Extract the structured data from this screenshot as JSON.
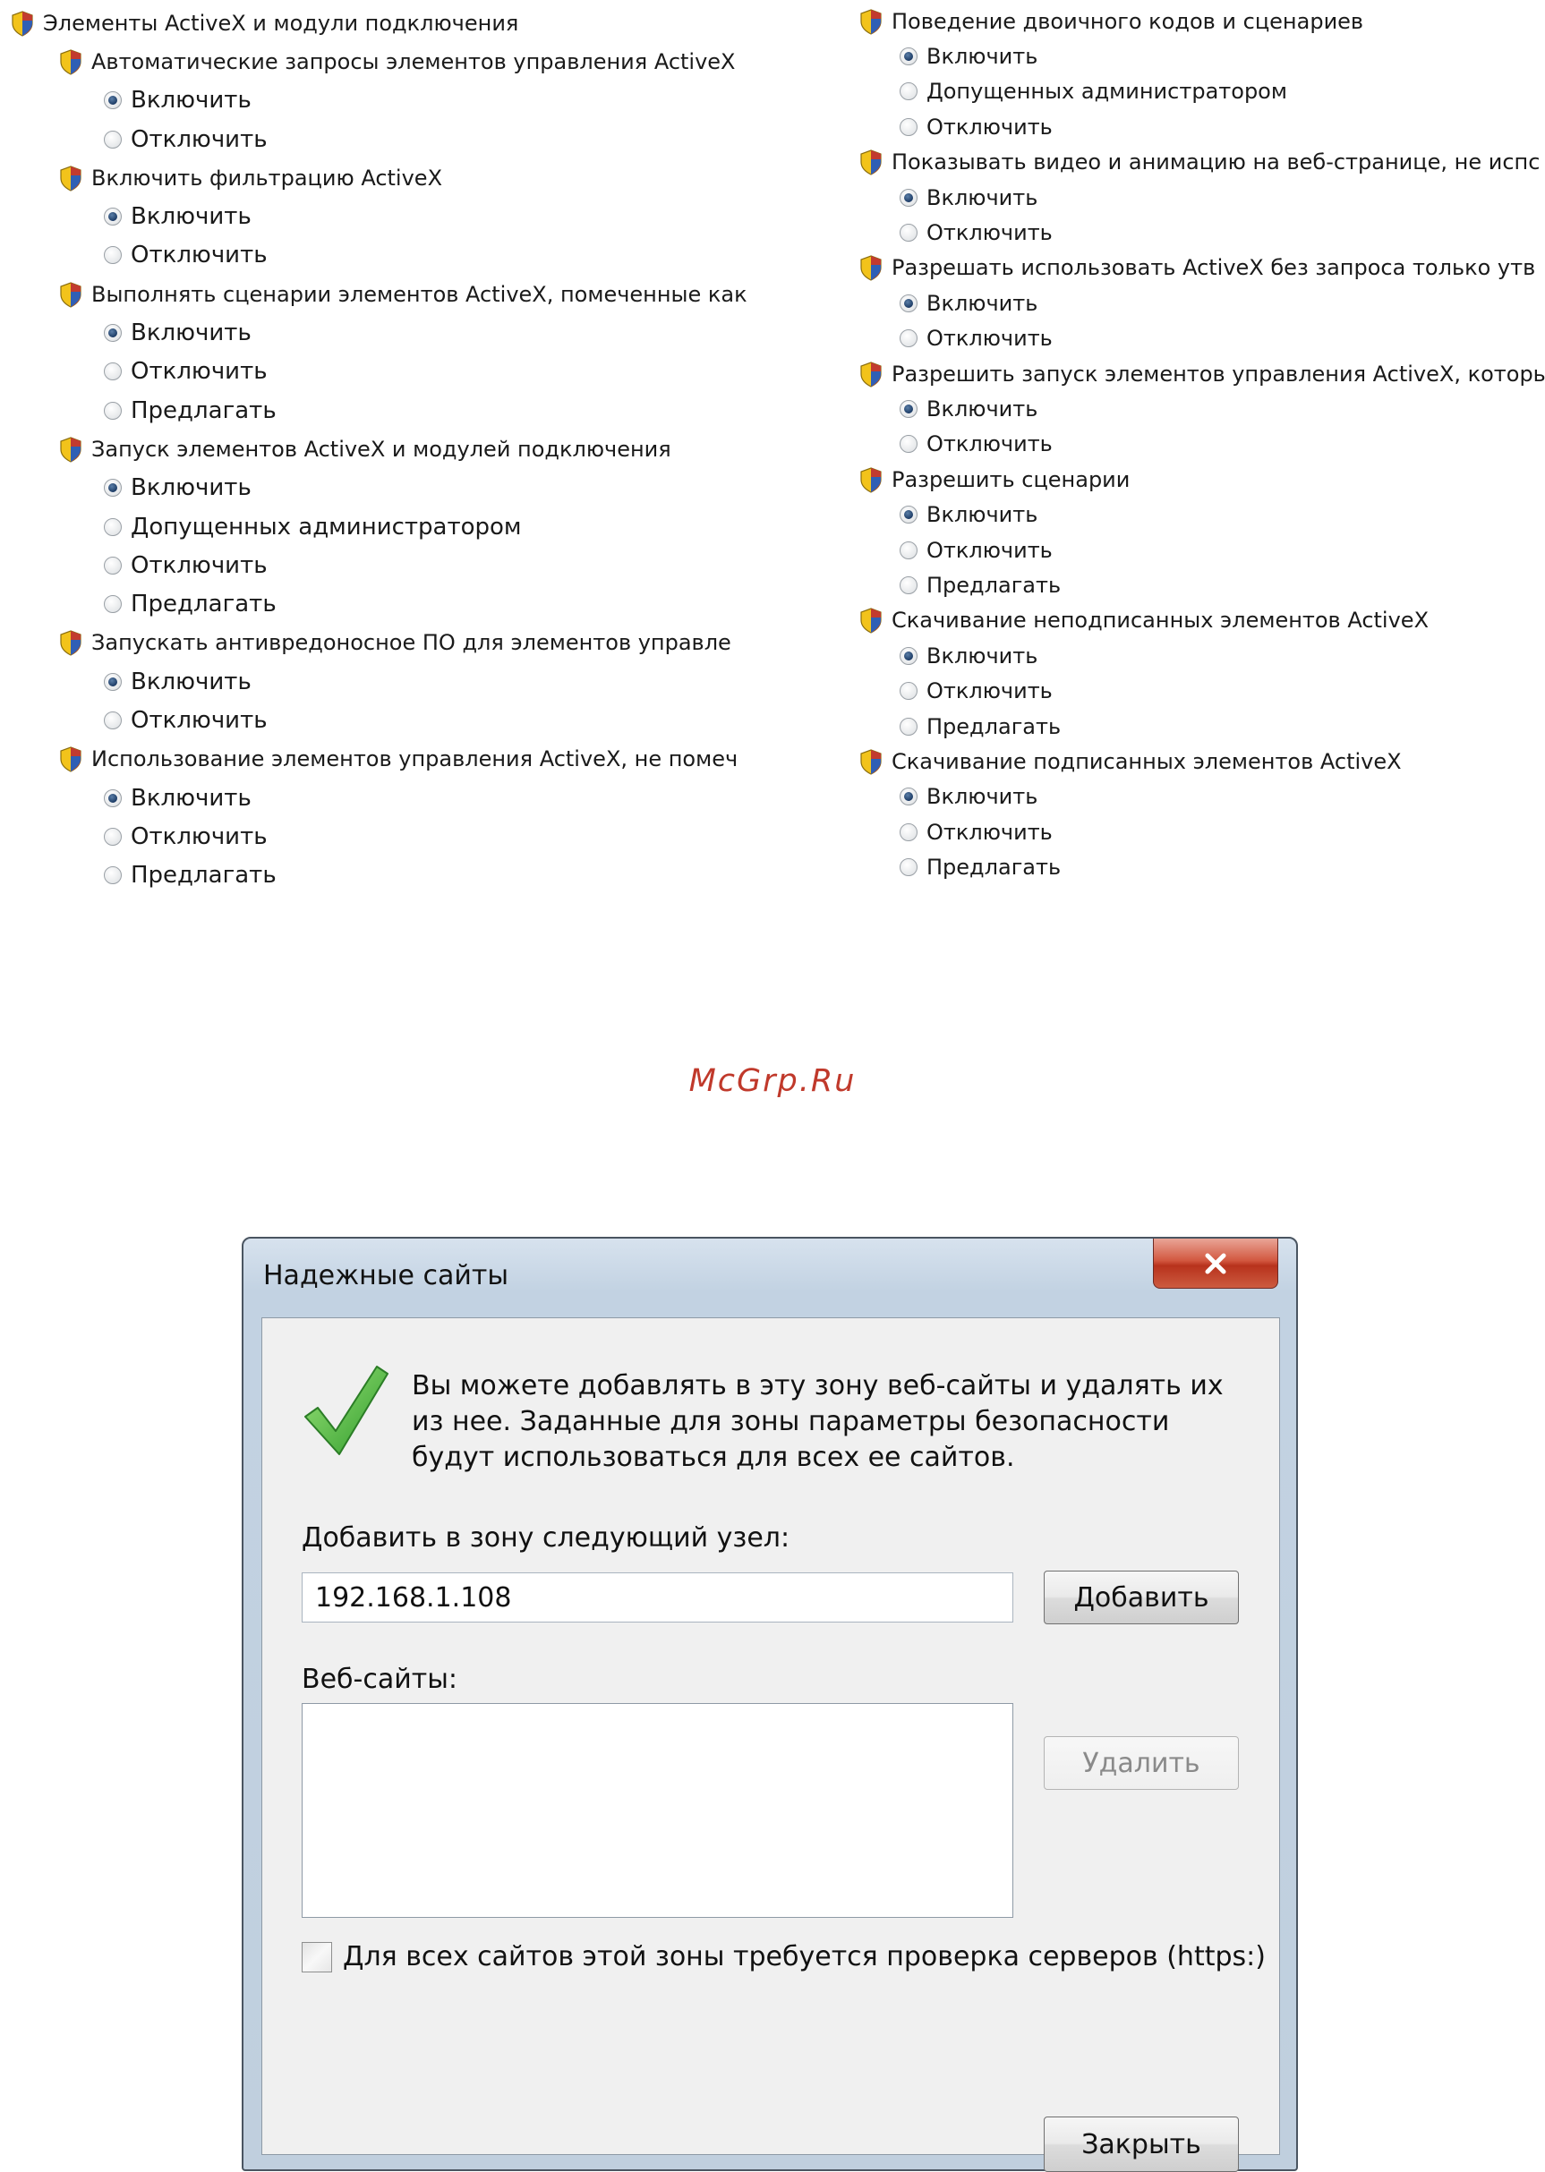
{
  "watermark": "McGrp.Ru",
  "left_column": {
    "group_title": "Элементы ActiveX и модули подключения",
    "settings": [
      {
        "label": "Автоматические запросы элементов управления ActiveX",
        "options": [
          {
            "label": "Включить",
            "selected": true
          },
          {
            "label": "Отключить",
            "selected": false
          }
        ]
      },
      {
        "label": "Включить фильтрацию ActiveX",
        "options": [
          {
            "label": "Включить",
            "selected": true
          },
          {
            "label": "Отключить",
            "selected": false
          }
        ]
      },
      {
        "label": "Выполнять сценарии элементов ActiveX, помеченные как",
        "options": [
          {
            "label": "Включить",
            "selected": true
          },
          {
            "label": "Отключить",
            "selected": false
          },
          {
            "label": "Предлагать",
            "selected": false
          }
        ]
      },
      {
        "label": "Запуск элементов ActiveX и модулей подключения",
        "options": [
          {
            "label": "Включить",
            "selected": true
          },
          {
            "label": "Допущенных администратором",
            "selected": false
          },
          {
            "label": "Отключить",
            "selected": false
          },
          {
            "label": "Предлагать",
            "selected": false
          }
        ]
      },
      {
        "label": "Запускать антивредоносное ПО для элементов управле",
        "options": [
          {
            "label": "Включить",
            "selected": true
          },
          {
            "label": "Отключить",
            "selected": false
          }
        ]
      },
      {
        "label": "Использование элементов управления ActiveX, не помеч",
        "options": [
          {
            "label": "Включить",
            "selected": true
          },
          {
            "label": "Отключить",
            "selected": false
          },
          {
            "label": "Предлагать",
            "selected": false
          }
        ]
      }
    ]
  },
  "right_column": {
    "settings": [
      {
        "label": "Поведение двоичного кодов и сценариев",
        "options": [
          {
            "label": "Включить",
            "selected": true
          },
          {
            "label": "Допущенных администратором",
            "selected": false
          },
          {
            "label": "Отключить",
            "selected": false
          }
        ]
      },
      {
        "label": "Показывать видео и анимацию на веб-странице, не испс",
        "options": [
          {
            "label": "Включить",
            "selected": true
          },
          {
            "label": "Отключить",
            "selected": false
          }
        ]
      },
      {
        "label": "Разрешать использовать ActiveX без запроса только утв",
        "options": [
          {
            "label": "Включить",
            "selected": true
          },
          {
            "label": "Отключить",
            "selected": false
          }
        ]
      },
      {
        "label": "Разрешить запуск элементов управления ActiveX, которы",
        "options": [
          {
            "label": "Включить",
            "selected": true
          },
          {
            "label": "Отключить",
            "selected": false
          }
        ]
      },
      {
        "label": "Разрешить сценарии",
        "options": [
          {
            "label": "Включить",
            "selected": true
          },
          {
            "label": "Отключить",
            "selected": false
          },
          {
            "label": "Предлагать",
            "selected": false
          }
        ]
      },
      {
        "label": "Скачивание неподписанных элементов ActiveX",
        "options": [
          {
            "label": "Включить",
            "selected": true
          },
          {
            "label": "Отключить",
            "selected": false
          },
          {
            "label": "Предлагать",
            "selected": false
          }
        ]
      },
      {
        "label": "Скачивание подписанных элементов ActiveX",
        "options": [
          {
            "label": "Включить",
            "selected": true
          },
          {
            "label": "Отключить",
            "selected": false
          },
          {
            "label": "Предлагать",
            "selected": false
          }
        ]
      }
    ]
  },
  "dialog": {
    "title": "Надежные сайты",
    "close_icon": "close-icon",
    "intro_text": "Вы можете добавлять в эту зону  веб-сайты и удалять их из нее. Заданные для зоны параметры безопасности будут использоваться для всех ее сайтов.",
    "add_label": "Добавить в зону следующий узел:",
    "site_input_value": "192.168.1.108",
    "add_button": "Добавить",
    "sites_label": "Веб-сайты:",
    "sites": [],
    "remove_button": "Удалить",
    "https_checkbox_label": "Для всех сайтов этой зоны требуется проверка серверов (https:)",
    "https_checked": false,
    "close_button": "Закрыть"
  }
}
